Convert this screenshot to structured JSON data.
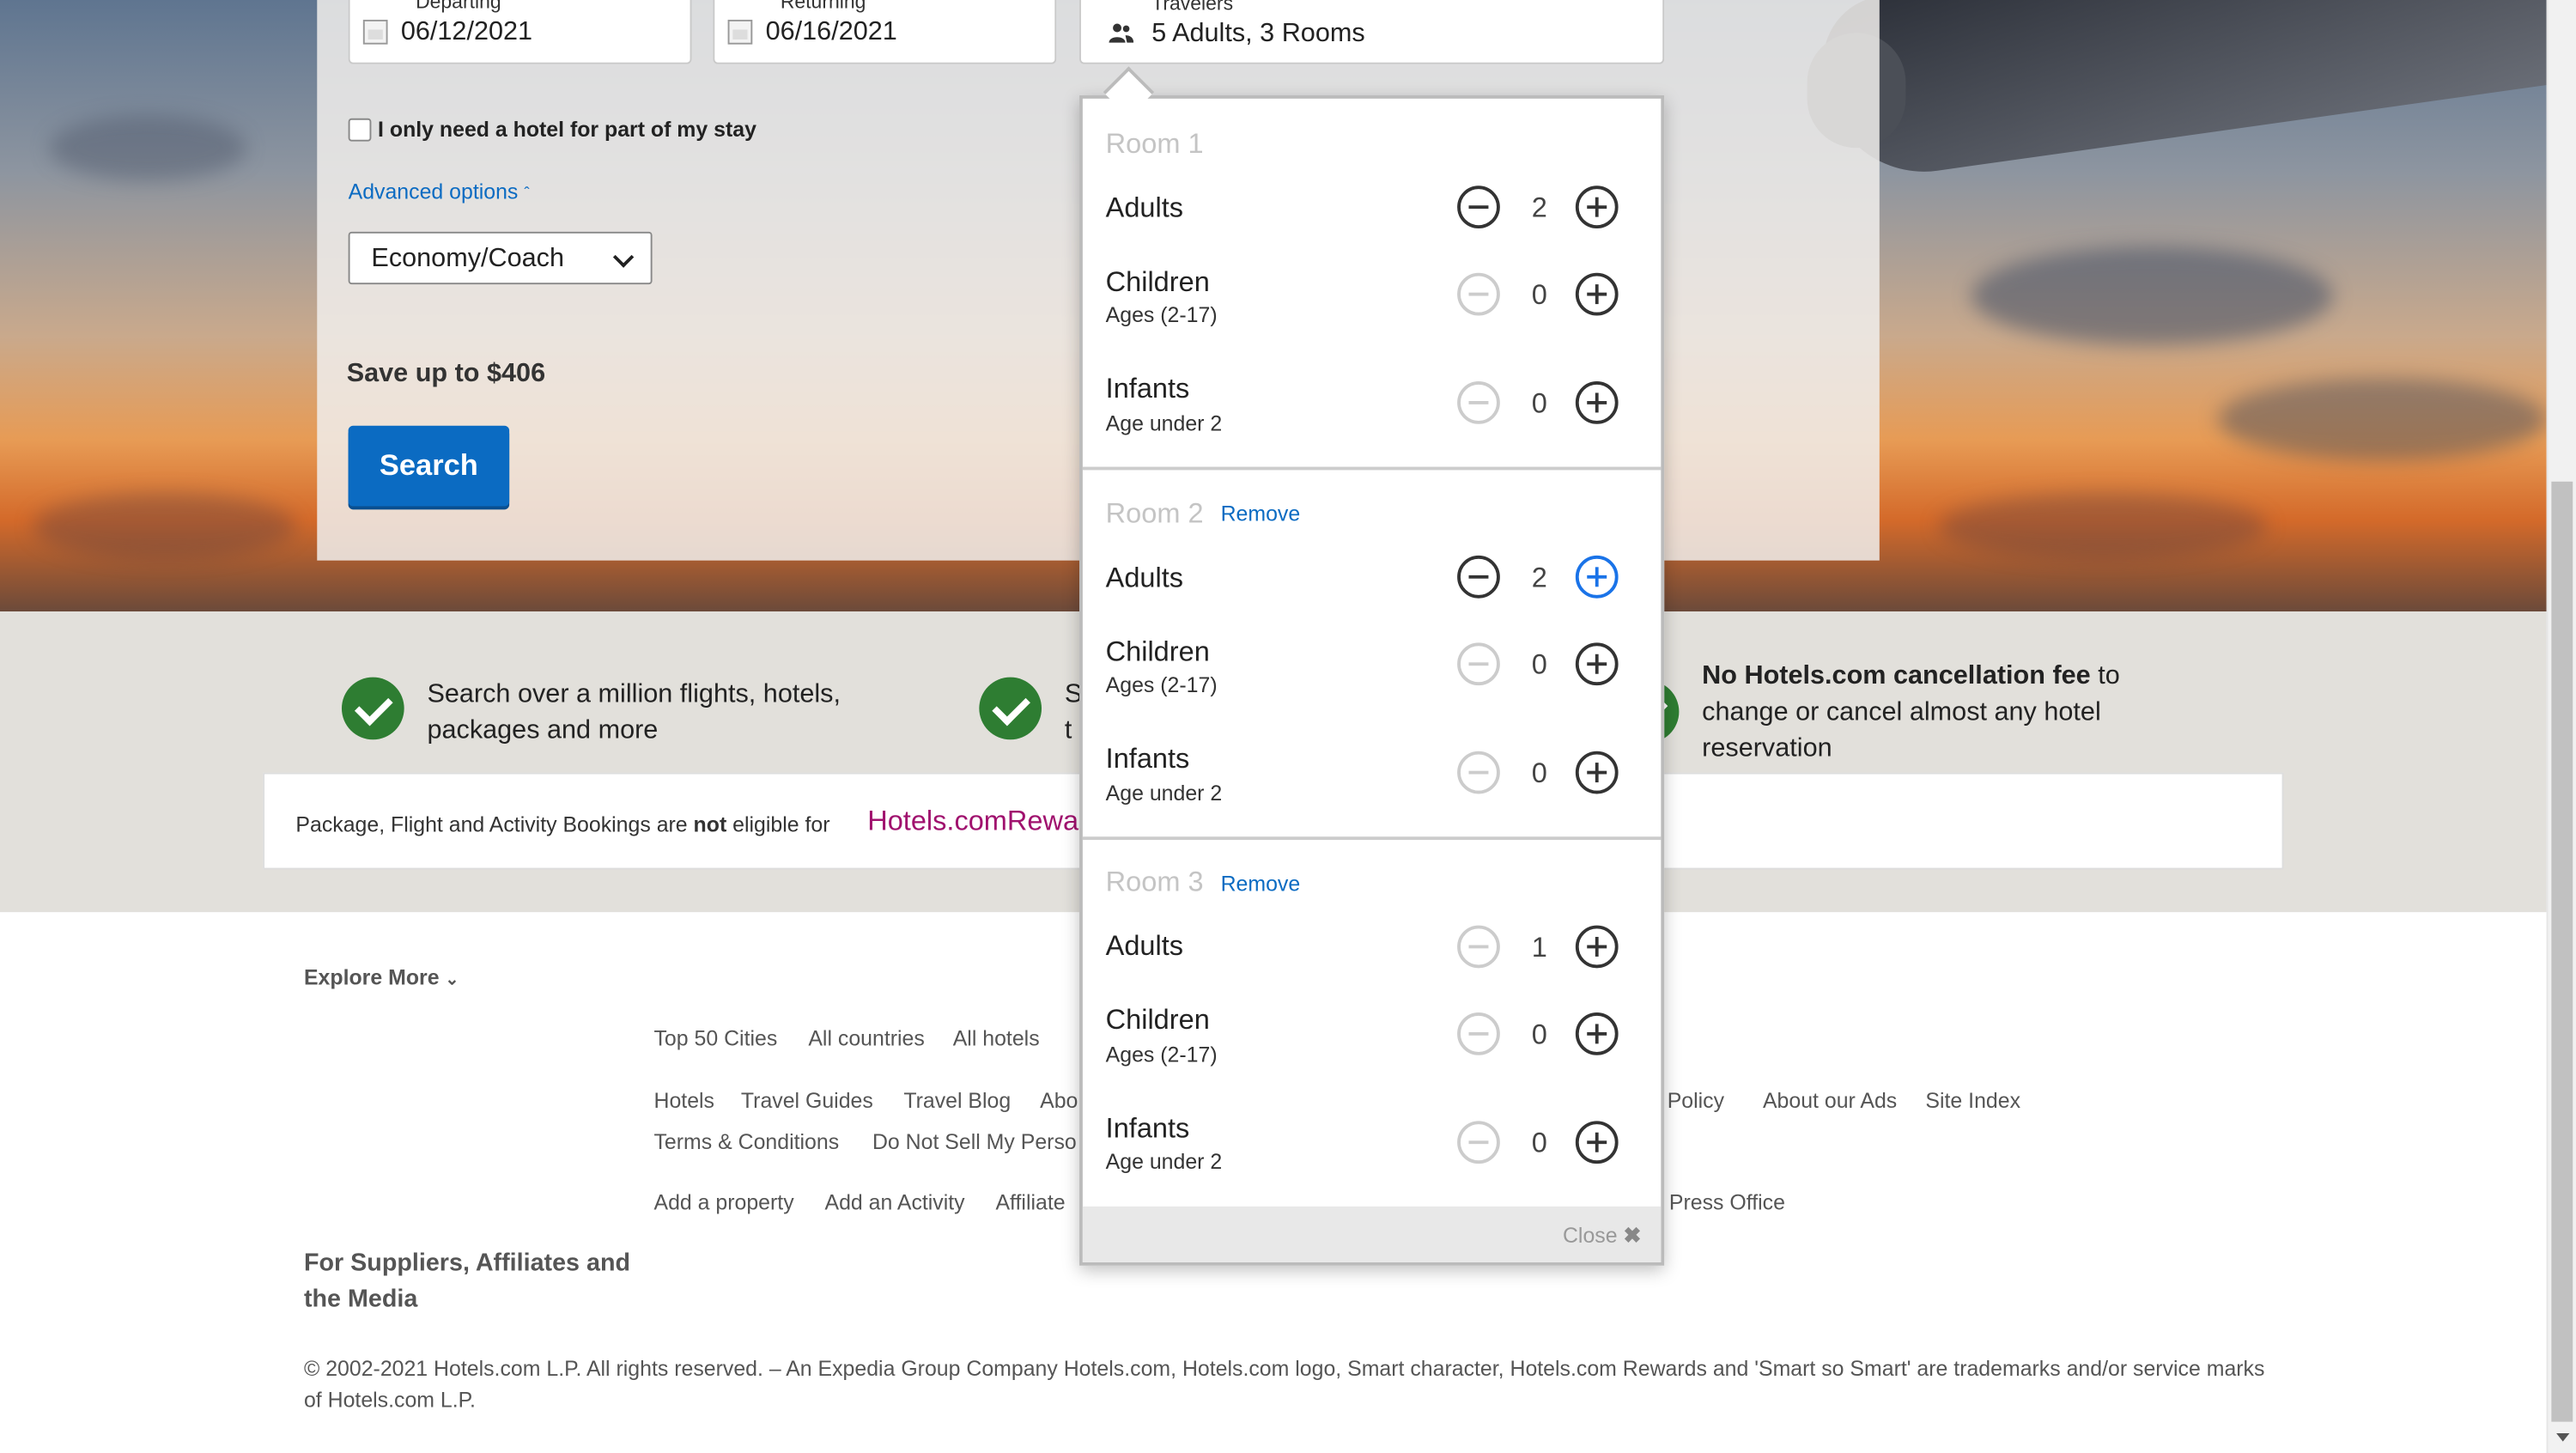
{
  "search_form": {
    "departing_label": "Departing",
    "departing_value": "06/12/2021",
    "returning_label": "Returning",
    "returning_value": "06/16/2021",
    "travelers_label": "Travelers",
    "travelers_value": "5 Adults, 3 Rooms",
    "partial_hotel_label": "I only need a hotel for part of my stay",
    "advanced_options": "Advanced options",
    "cabin_class": "Economy/Coach",
    "savings": "Save up to $406",
    "search_button": "Search"
  },
  "travelers_popover": {
    "rooms": [
      {
        "title": "Room 1",
        "remove": "",
        "rows": [
          {
            "label": "Adults",
            "sub": "",
            "count": "2"
          },
          {
            "label": "Children",
            "sub": "Ages (2-17)",
            "count": "0"
          },
          {
            "label": "Infants",
            "sub": "Age under 2",
            "count": "0"
          }
        ]
      },
      {
        "title": "Room 2",
        "remove": "Remove",
        "rows": [
          {
            "label": "Adults",
            "sub": "",
            "count": "2"
          },
          {
            "label": "Children",
            "sub": "Ages (2-17)",
            "count": "0"
          },
          {
            "label": "Infants",
            "sub": "Age under 2",
            "count": "0"
          }
        ]
      },
      {
        "title": "Room 3",
        "remove": "Remove",
        "rows": [
          {
            "label": "Adults",
            "sub": "",
            "count": "1"
          },
          {
            "label": "Children",
            "sub": "Ages (2-17)",
            "count": "0"
          },
          {
            "label": "Infants",
            "sub": "Age under 2",
            "count": "0"
          }
        ]
      }
    ],
    "close": "Close"
  },
  "features": {
    "item1": "Search over a million flights, hotels, packages and more",
    "item2_part1": "S",
    "item2_part2": "t",
    "item3_bold": "No Hotels.com cancellation fee",
    "item3_rest": " to change or cancel almost any hotel reservation"
  },
  "rewards": {
    "text_before": "Package, Flight and Activity Bookings are ",
    "text_bold": "not",
    "text_after": " eligible for",
    "logo": "Hotels.comRewar"
  },
  "footer": {
    "explore_more": "Explore More",
    "row1": [
      "Top 50 Cities",
      "All countries",
      "All hotels"
    ],
    "row2": [
      "Hotels",
      "Travel Guides",
      "Travel Blog",
      "Abo"
    ],
    "row2_right": [
      "e Policy",
      "About our Ads",
      "Site Index"
    ],
    "row3": [
      "Terms & Conditions",
      "Do Not Sell My Perso"
    ],
    "row4": [
      "Add a property",
      "Add an Activity",
      "Affiliate"
    ],
    "row4_right": [
      "Press Office"
    ],
    "suppliers_heading": "For Suppliers, Affiliates and the Media",
    "copyright": "© 2002-2021 Hotels.com L.P. All rights reserved. – An Expedia Group Company Hotels.com, Hotels.com logo, Smart character, Hotels.com Rewards and 'Smart so Smart' are trademarks and/or service marks of Hotels.com L.P."
  },
  "colors": {
    "brand_blue": "#0b6bc2",
    "check_green": "#2e7d32",
    "rewards_magenta": "#a0116e"
  }
}
